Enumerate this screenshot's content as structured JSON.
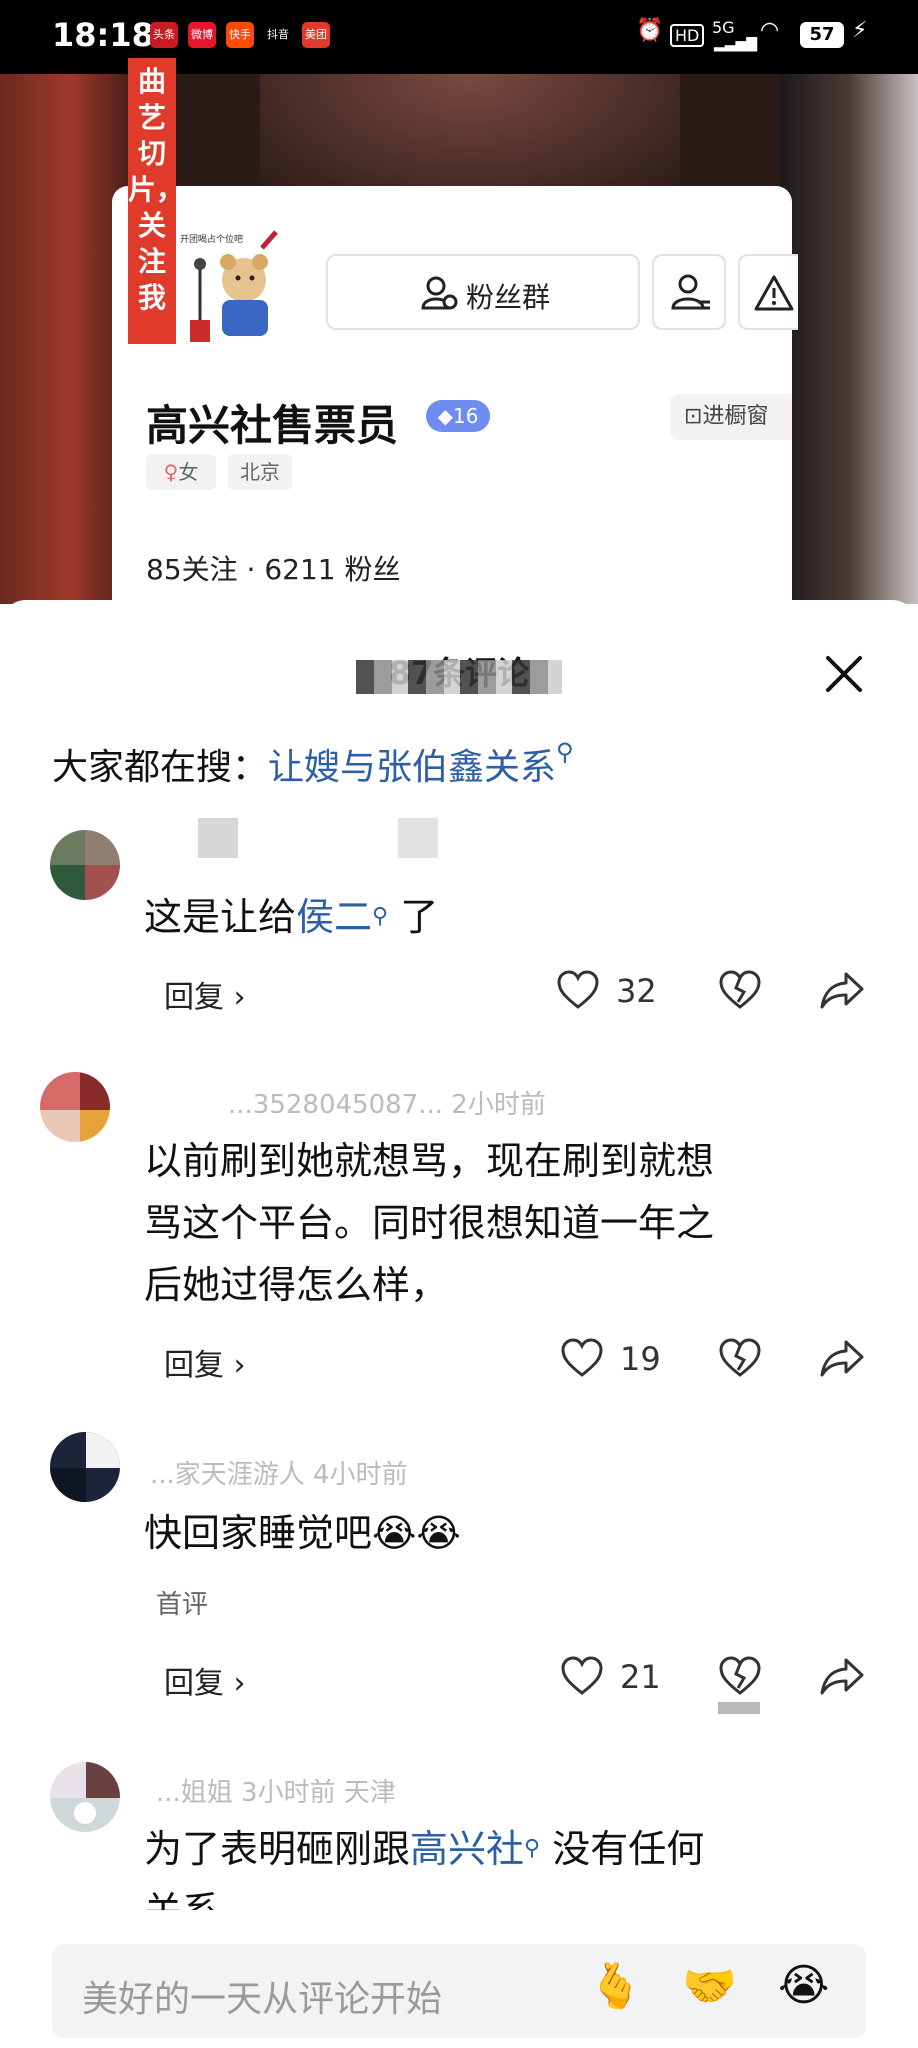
{
  "status_bar": {
    "time": "18:18",
    "apps": [
      "头条",
      "微博",
      "快手",
      "抖音",
      "美团"
    ],
    "network": "5G",
    "battery": "57"
  },
  "profile_card": {
    "banner_text": "曲艺切片，关注我",
    "logo_caption": "开团喝占个位吧",
    "fan_group_button": "粉丝群",
    "name": "高兴社售票员",
    "level": "16",
    "shop_button": "进橱窗",
    "gender": "女",
    "location": "北京",
    "stats": "85关注 · 6211 粉丝"
  },
  "comments_sheet": {
    "title": "87条评论",
    "search_prefix": "大家都在搜：",
    "search_hint": "让嫂与张伯鑫关系"
  },
  "comments": [
    {
      "text_before": "这是让给",
      "link": "侯二",
      "text_after": " 了",
      "meta": "",
      "reply": "回复",
      "likes": "32"
    },
    {
      "meta": "...3528045087...  2小时前",
      "text_line1": "以前刷到她就想骂，现在刷到就想",
      "text_line2": "骂这个平台。同时很想知道一年之",
      "text_line3": "后她过得怎么样，",
      "reply": "回复",
      "likes": "19"
    },
    {
      "meta": "...家天涯游人  4小时前",
      "text": "快回家睡觉吧",
      "emoji": "😭😭",
      "badge": "首评",
      "reply": "回复",
      "likes": "21"
    },
    {
      "meta": "...姐姐  3小时前  天津",
      "text_before": "为了表明砸刚跟",
      "link": "高兴社",
      "text_after": " 没有任何",
      "text_line2": "关系"
    }
  ],
  "input_bar": {
    "placeholder": "美好的一天从评论开始",
    "emojis": [
      "🫰",
      "🤝",
      "😭"
    ]
  }
}
